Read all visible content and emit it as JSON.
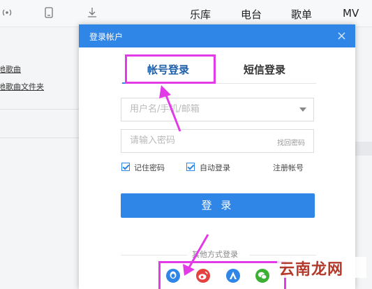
{
  "app": {
    "nav_tabs": [
      "乐库",
      "电台",
      "歌单",
      "MV"
    ],
    "left_links": [
      "本地歌曲",
      "本地歌曲文件夹"
    ]
  },
  "dialog": {
    "title": "登录帐户",
    "close": "×",
    "tabs": [
      {
        "label": "帐号登录",
        "active": true
      },
      {
        "label": "短信登录",
        "active": false
      }
    ],
    "username_placeholder": "用户名/手机/邮箱",
    "password_placeholder": "请输入密码",
    "forgot_password": "找回密码",
    "remember_password": "记住密码",
    "auto_login": "自动登录",
    "register": "注册帐号",
    "login_button": "登 录",
    "other_methods": "其他方式登录",
    "social": [
      "qq-icon",
      "weibo-icon",
      "baidu-icon",
      "wechat-icon"
    ]
  },
  "colors": {
    "accent": "#2f86e6",
    "highlight": "#e23ae6",
    "watermark": "#b33a2b"
  },
  "watermark": "云南龙网"
}
